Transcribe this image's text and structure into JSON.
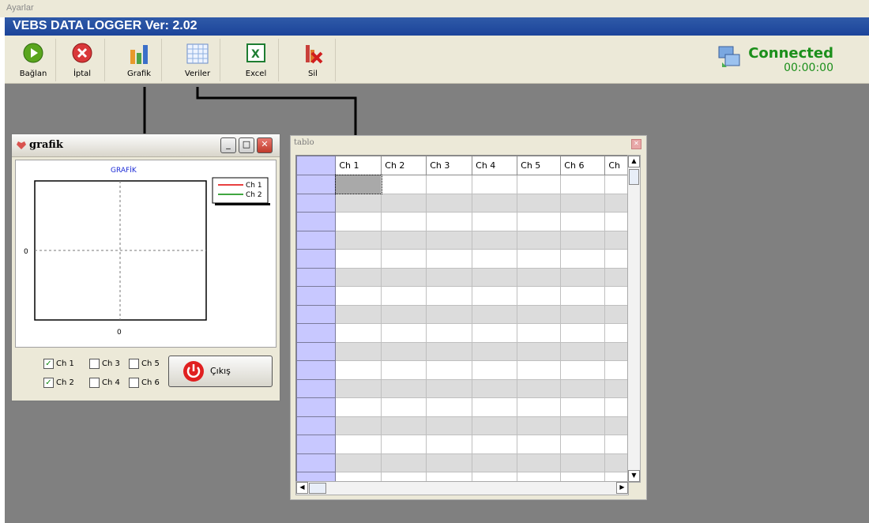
{
  "menu": {
    "title": "Ayarlar"
  },
  "app": {
    "title": "VEBS DATA LOGGER Ver: 2.02"
  },
  "toolbar": {
    "connect": "Bağlan",
    "cancel": "İptal",
    "graph": "Grafik",
    "data": "Veriler",
    "excel": "Excel",
    "delete": "Sil"
  },
  "status": {
    "connection": "Connected",
    "timer": "00:00:00"
  },
  "grafik_window": {
    "title": "grafik",
    "chart_title": "GRAFİK",
    "y_tick": "0",
    "x_tick": "0",
    "legend": [
      "Ch 1",
      "Ch 2"
    ],
    "channels": [
      {
        "label": "Ch 1",
        "checked": true
      },
      {
        "label": "Ch 2",
        "checked": true
      },
      {
        "label": "Ch 3",
        "checked": false
      },
      {
        "label": "Ch 4",
        "checked": false
      },
      {
        "label": "Ch 5",
        "checked": false
      },
      {
        "label": "Ch 6",
        "checked": false
      }
    ],
    "exit_label": "Çıkış"
  },
  "tablo_window": {
    "title": "tablo",
    "columns": [
      "Ch 1",
      "Ch 2",
      "Ch 3",
      "Ch 4",
      "Ch 5",
      "Ch 6",
      "Ch"
    ]
  },
  "colors": {
    "titlebar": "#2f5aa8",
    "connected": "#1b8f1b",
    "legend_ch1": "#e00000",
    "legend_ch2": "#008800",
    "row_header": "#c8c8ff"
  }
}
